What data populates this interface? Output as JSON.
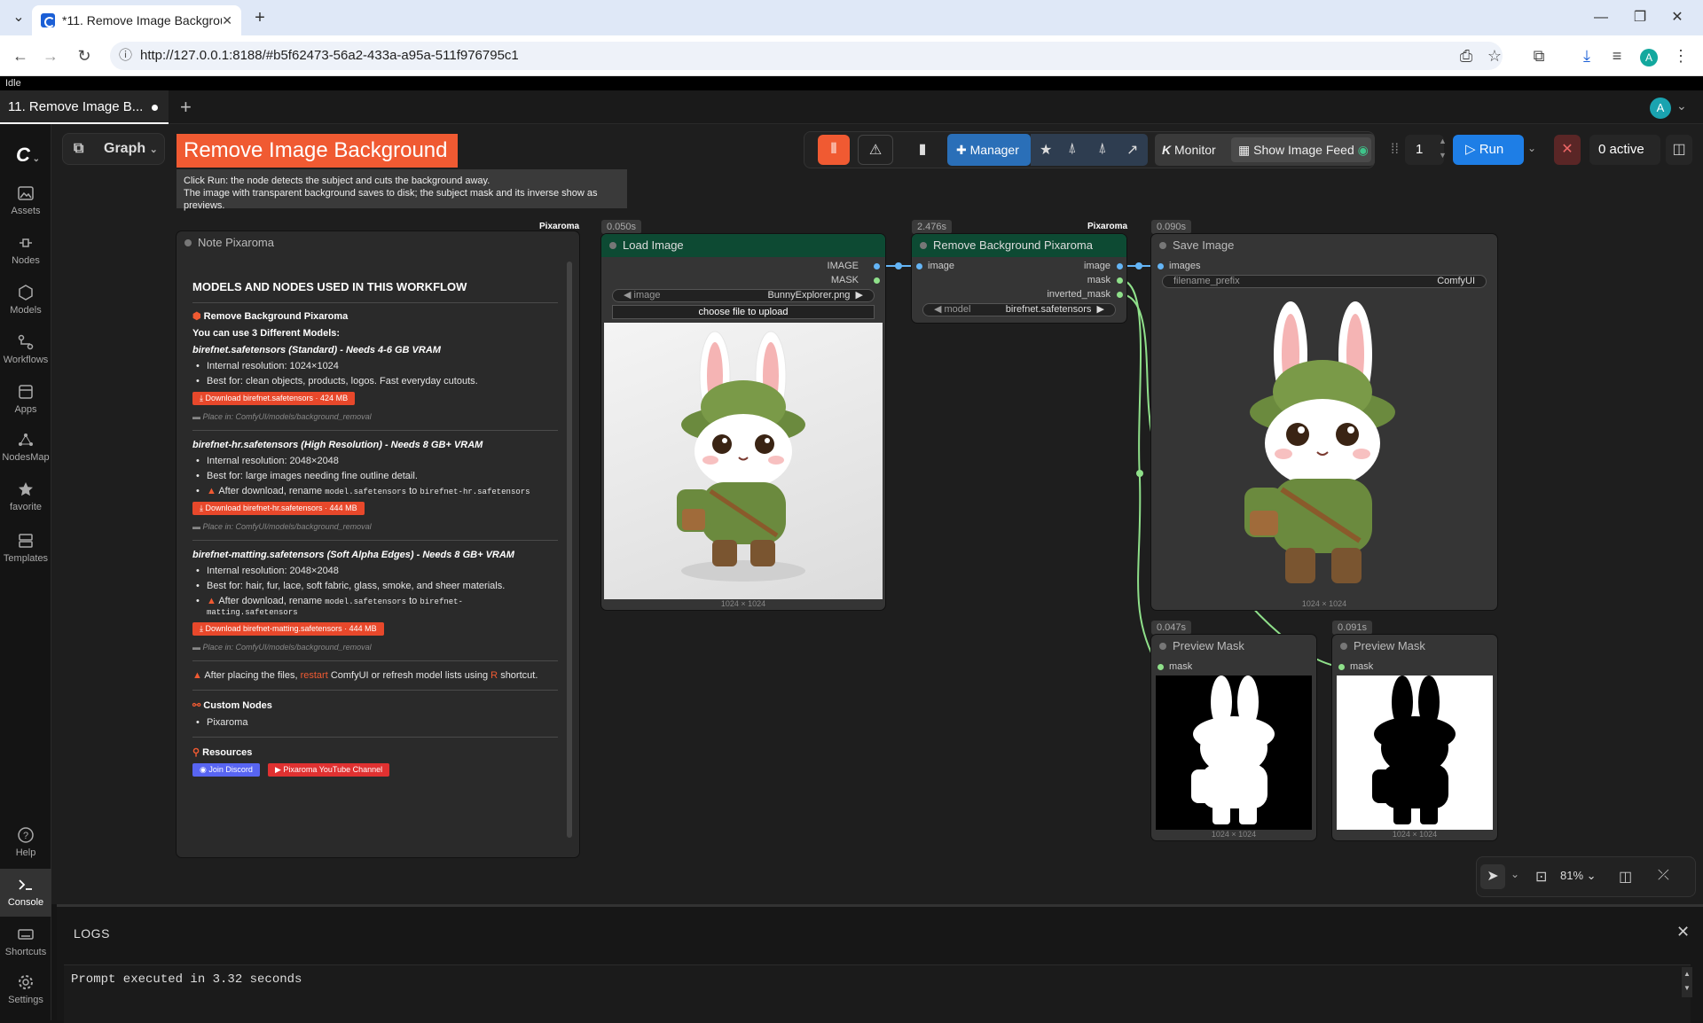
{
  "browser": {
    "tab_title": "*11. Remove Image Backgroun",
    "url": "http://127.0.0.1:8188/#b5f62473-56a2-433a-a95a-511f976795c1",
    "avatar": "A"
  },
  "status": "Idle",
  "workflow_tab": "11. Remove Image B...",
  "user_avatar": "A",
  "sidebar": {
    "items": [
      {
        "label": "Assets",
        "icon": "image-icon"
      },
      {
        "label": "Nodes",
        "icon": "node-icon"
      },
      {
        "label": "Models",
        "icon": "cube-icon"
      },
      {
        "label": "Workflows",
        "icon": "workflow-icon"
      },
      {
        "label": "Apps",
        "icon": "apps-icon"
      },
      {
        "label": "NodesMap",
        "icon": "map-icon"
      },
      {
        "label": "favorite",
        "icon": "star-icon"
      },
      {
        "label": "Templates",
        "icon": "template-icon"
      }
    ],
    "bottom": [
      {
        "label": "Help",
        "icon": "help-icon"
      },
      {
        "label": "Console",
        "icon": "console-icon"
      },
      {
        "label": "Shortcuts",
        "icon": "keyboard-icon"
      },
      {
        "label": "Settings",
        "icon": "gear-icon"
      }
    ]
  },
  "graph_button": "Graph",
  "title_banner": "Remove Image Background",
  "title_sub_1": "Click Run: the node detects the subject and cuts the background away.",
  "title_sub_2": "The image with transparent background saves to disk; the subject mask and its inverse show as previews.",
  "toolbar": {
    "manager": "Manager",
    "monitor": "Monitor",
    "image_feed": "Show Image Feed",
    "queue_count": "1",
    "run": "Run",
    "active": "0 active"
  },
  "note": {
    "badge": "Pixaroma",
    "title": "Note Pixaroma",
    "heading": "MODELS AND NODES USED IN THIS WORKFLOW",
    "node_name": "Remove Background Pixaroma",
    "models_intro": "You can use 3 Different Models:",
    "m1_title": "birefnet.safetensors (Standard) - Needs 4-6 GB VRAM",
    "m1_li1": "Internal resolution: 1024×1024",
    "m1_li2": "Best for: clean objects, products, logos. Fast everyday cutouts.",
    "m1_dl": "Download birefnet.safetensors · 424 MB",
    "m1_place": "Place in: ComfyUI/models/background_removal",
    "m2_title": "birefnet-hr.safetensors (High Resolution) - Needs 8 GB+ VRAM",
    "m2_li1": "Internal resolution: 2048×2048",
    "m2_li2": "Best for: large images needing fine outline detail.",
    "m2_li3_a": "After download, rename",
    "m2_li3_code1": "model.safetensors",
    "m2_li3_to": "to",
    "m2_li3_code2": "birefnet-hr.safetensors",
    "m2_dl": "Download birefnet-hr.safetensors · 444 MB",
    "m2_place": "Place in: ComfyUI/models/background_removal",
    "m3_title": "birefnet-matting.safetensors (Soft Alpha Edges) - Needs 8 GB+ VRAM",
    "m3_li1": "Internal resolution: 2048×2048",
    "m3_li2": "Best for: hair, fur, lace, soft fabric, glass, smoke, and sheer materials.",
    "m3_li3_a": "After download, rename",
    "m3_li3_code1": "model.safetensors",
    "m3_li3_to": "to",
    "m3_li3_code2": "birefnet-",
    "m3_li3_code3": "matting.safetensors",
    "m3_dl": "Download birefnet-matting.safetensors · 444 MB",
    "m3_place": "Place in: ComfyUI/models/background_removal",
    "warn_a": "After placing the files,",
    "warn_restart": "restart",
    "warn_b": "ComfyUI or refresh model lists using",
    "warn_key": "R",
    "warn_c": "shortcut.",
    "custom_nodes": "Custom Nodes",
    "custom_item": "Pixaroma",
    "resources": "Resources",
    "discord": "Join Discord",
    "youtube": "Pixaroma YouTube Channel"
  },
  "load_image": {
    "time": "0.050s",
    "title": "Load Image",
    "out1": "IMAGE",
    "out2": "MASK",
    "widget_label": "image",
    "widget_value": "BunnyExplorer.png",
    "upload": "choose file to upload",
    "size": "1024 × 1024"
  },
  "remove_bg": {
    "time": "2.476s",
    "badge": "Pixaroma",
    "title": "Remove Background Pixaroma",
    "in1": "image",
    "out1": "image",
    "out2": "mask",
    "out3": "inverted_mask",
    "widget_label": "model",
    "widget_value": "birefnet.safetensors"
  },
  "save_image": {
    "time": "0.090s",
    "title": "Save Image",
    "in1": "images",
    "widget_label": "filename_prefix",
    "widget_value": "ComfyUI",
    "size": "1024 × 1024"
  },
  "preview1": {
    "time": "0.047s",
    "title": "Preview Mask",
    "in1": "mask",
    "size": "1024 × 1024"
  },
  "preview2": {
    "time": "0.091s",
    "title": "Preview Mask",
    "in1": "mask",
    "size": "1024 × 1024"
  },
  "canvas_tools": {
    "zoom": "81%"
  },
  "logs": {
    "title": "LOGS",
    "output": "Prompt executed in 3.32 seconds"
  },
  "colors": {
    "accent_orange": "#f05a32",
    "run_blue": "#1e7ee6",
    "manager_blue": "#2a6fb8",
    "link_blue": "#64b5f6",
    "link_green": "#8fe08a",
    "node_green": "#0d4a33"
  }
}
